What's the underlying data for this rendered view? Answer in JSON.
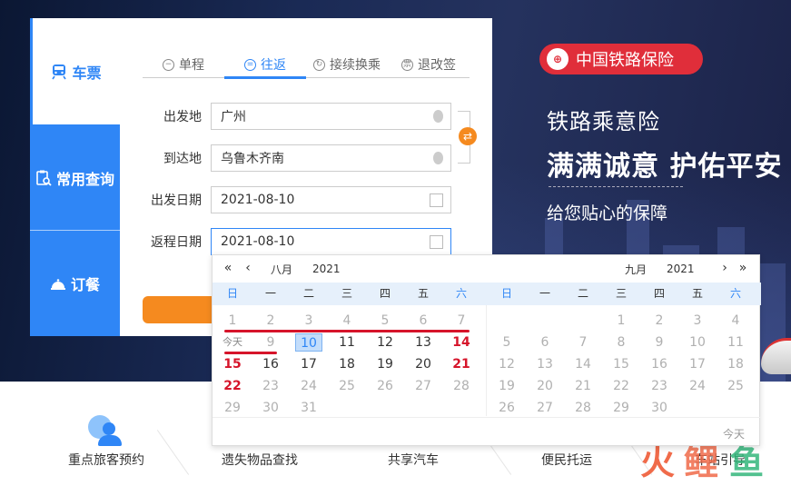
{
  "nav": {
    "items": [
      {
        "label": "车票",
        "icon": "train-icon"
      },
      {
        "label": "常用查询",
        "icon": "clipboard-search-icon"
      },
      {
        "label": "订餐",
        "icon": "food-cloche-icon"
      }
    ]
  },
  "tabs": [
    {
      "label": "单程",
      "icon": "minus-circle-icon"
    },
    {
      "label": "往返",
      "icon": "equal-circle-icon"
    },
    {
      "label": "接续换乘",
      "icon": "transfer-circle-icon"
    },
    {
      "label": "退改签",
      "icon": "refund-circle-icon"
    }
  ],
  "form": {
    "from": {
      "label": "出发地",
      "value": "广州"
    },
    "to": {
      "label": "到达地",
      "value": "乌鲁木齐南"
    },
    "depart": {
      "label": "出发日期",
      "value": "2021-08-10"
    },
    "return": {
      "label": "返程日期",
      "value": "2021-08-10"
    },
    "swap_glyph": "⇄"
  },
  "promo": {
    "brand": "中国铁路保险",
    "line1": "铁路乘意险",
    "line2": "满满诚意 护佑平安",
    "line3": "给您贴心的保障"
  },
  "services": [
    "重点旅客预约",
    "遗失物品查找",
    "共享汽车",
    "便民托运",
    "车站引导"
  ],
  "watermark": {
    "c1": "火",
    "c2": "鲤",
    "c3": "鱼"
  },
  "calendar": {
    "prev_year": "«",
    "prev_month": "‹",
    "next_month": "›",
    "next_year": "»",
    "left": {
      "month": "八月",
      "year": "2021"
    },
    "right": {
      "month": "九月",
      "year": "2021"
    },
    "weekdays": [
      "日",
      "一",
      "二",
      "三",
      "四",
      "五",
      "六"
    ],
    "today_label": "今天",
    "footer_today": "今天",
    "aug_rows": [
      [
        "1",
        "2",
        "3",
        "4",
        "5",
        "6",
        "7"
      ],
      [
        "今天",
        "9",
        "10",
        "11",
        "12",
        "13",
        "14"
      ],
      [
        "15",
        "16",
        "17",
        "18",
        "19",
        "20",
        "21"
      ],
      [
        "22",
        "23",
        "24",
        "25",
        "26",
        "27",
        "28"
      ],
      [
        "29",
        "30",
        "31",
        "",
        "",
        "",
        ""
      ]
    ],
    "sep_rows": [
      [
        "",
        "",
        "",
        "1",
        "2",
        "3",
        "4"
      ],
      [
        "5",
        "6",
        "7",
        "8",
        "9",
        "10",
        "11"
      ],
      [
        "12",
        "13",
        "14",
        "15",
        "16",
        "17",
        "18"
      ],
      [
        "19",
        "20",
        "21",
        "22",
        "23",
        "24",
        "25"
      ],
      [
        "26",
        "27",
        "28",
        "29",
        "30",
        "",
        ""
      ]
    ]
  },
  "colors": {
    "accent": "#2f86f6",
    "orange": "#f58a1f",
    "red": "#d6142a",
    "brand_red": "#e02e3a"
  }
}
